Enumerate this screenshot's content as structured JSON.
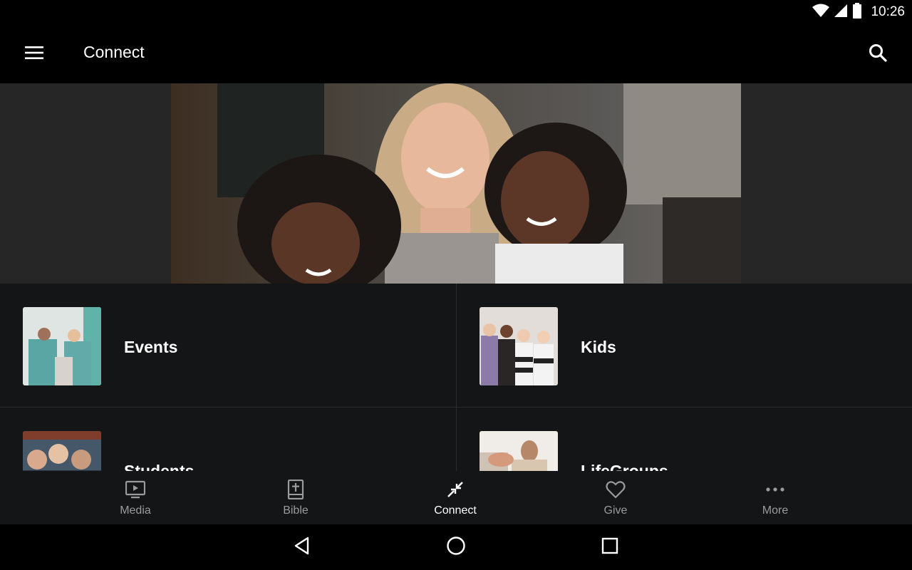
{
  "status_bar": {
    "time": "10:26",
    "icons": [
      "wifi-icon",
      "cell-signal-icon",
      "battery-icon"
    ]
  },
  "app_bar": {
    "title": "Connect",
    "menu_icon": "hamburger-menu-icon",
    "search_icon": "search-icon"
  },
  "hero": {
    "image": "woman-with-two-children-photo"
  },
  "tiles": [
    {
      "label": "Events",
      "thumb": "events-photo"
    },
    {
      "label": "Kids",
      "thumb": "kids-photo"
    },
    {
      "label": "Students",
      "thumb": "students-photo"
    },
    {
      "label": "LifeGroups",
      "thumb": "lifegroups-photo"
    }
  ],
  "bottom_nav": {
    "items": [
      {
        "label": "Media",
        "icon": "tv-play-icon",
        "active": false
      },
      {
        "label": "Bible",
        "icon": "bible-cross-icon",
        "active": false
      },
      {
        "label": "Connect",
        "icon": "connect-arrows-icon",
        "active": true
      },
      {
        "label": "Give",
        "icon": "heart-icon",
        "active": false
      },
      {
        "label": "More",
        "icon": "more-dots-icon",
        "active": false
      }
    ]
  },
  "system_nav": {
    "buttons": [
      "back-icon",
      "home-icon",
      "recents-icon"
    ]
  },
  "colors": {
    "background": "#000000",
    "surface": "#141517",
    "hero_side": "#262626",
    "nav_inactive": "#9a9b9d",
    "nav_active": "#ffffff"
  }
}
